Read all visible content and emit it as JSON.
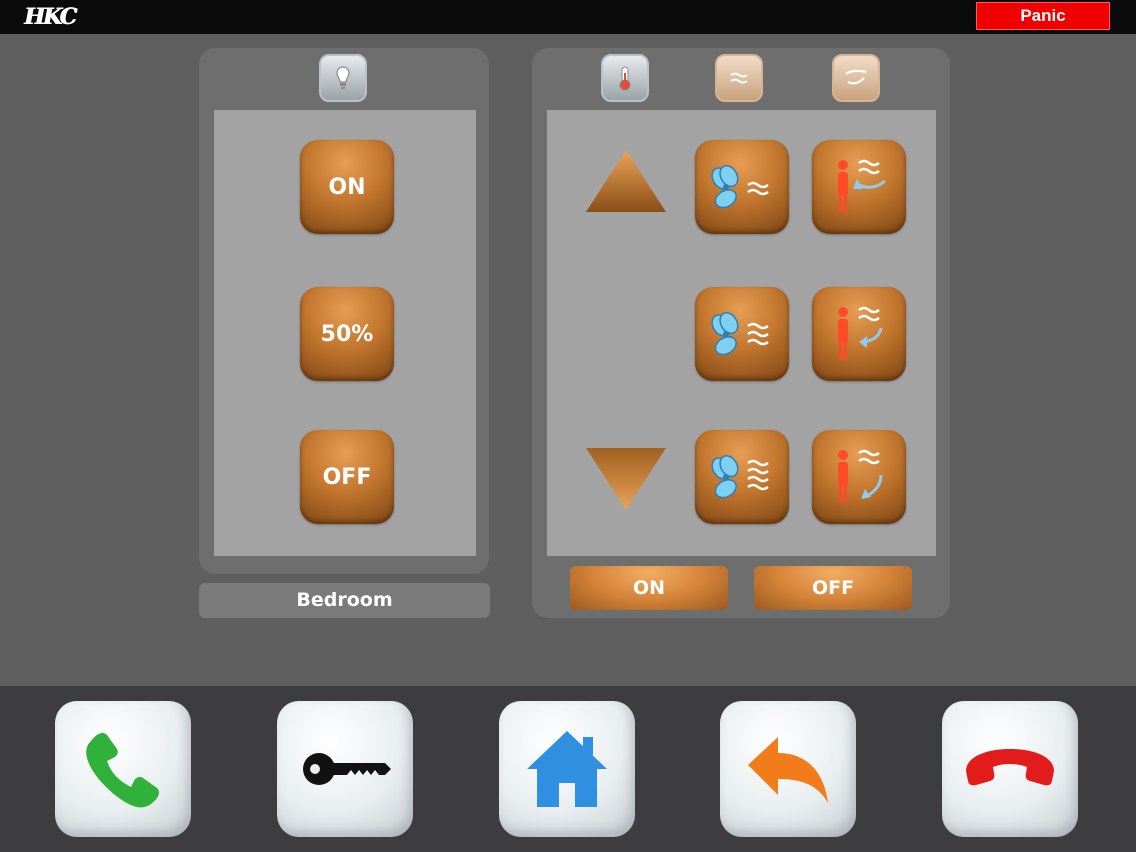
{
  "header": {
    "logo_text": "HKC",
    "panic_label": "Panic"
  },
  "light_panel": {
    "tab_icon": "bulb-icon",
    "buttons": [
      "ON",
      "50%",
      "OFF"
    ],
    "room_label": "Bedroom"
  },
  "ac_panel": {
    "tab_icons": [
      "thermometer-icon",
      "fan-wave-icon",
      "airflow-icon"
    ],
    "up_arrow": "arrow-up-icon",
    "down_arrow": "arrow-down-icon",
    "fan_buttons": [
      "fan-low-icon",
      "fan-medium-icon",
      "fan-high-icon"
    ],
    "swing_buttons": [
      "swing-up-icon",
      "swing-middle-icon",
      "swing-down-icon"
    ],
    "on_label": "ON",
    "off_label": "OFF"
  },
  "dock": {
    "buttons": [
      "phone-icon",
      "key-icon",
      "home-icon",
      "back-icon",
      "hangup-icon"
    ]
  },
  "colors": {
    "panic": "#f00000",
    "bronze": "#c2762e",
    "phone_green": "#2fb13a",
    "home_blue": "#2f8fe0",
    "back_orange": "#f27c1a",
    "hangup_red": "#e21b1b"
  }
}
